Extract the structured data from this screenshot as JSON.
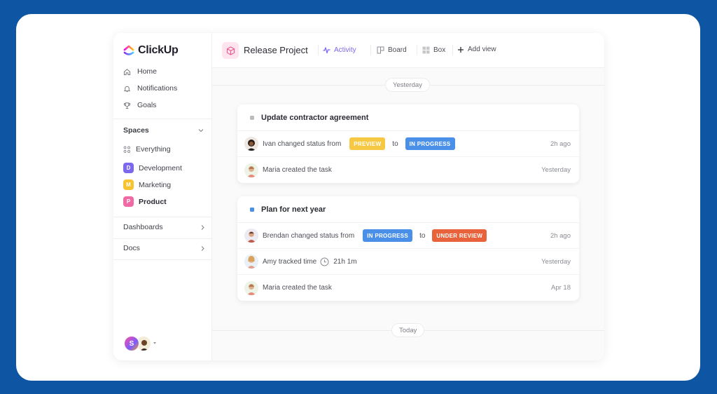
{
  "colors": {
    "background": "#0E55A3",
    "accent": "#7B68EE",
    "preview": "#F7C844",
    "in_progress": "#4A90E8",
    "under_review": "#E8623B"
  },
  "sidebar": {
    "logo_text": "ClickUp",
    "nav": [
      {
        "label": "Home",
        "icon": "home-icon"
      },
      {
        "label": "Notifications",
        "icon": "bell-icon"
      },
      {
        "label": "Goals",
        "icon": "trophy-icon"
      }
    ],
    "spaces_title": "Spaces",
    "everything_label": "Everything",
    "spaces": [
      {
        "letter": "D",
        "label": "Development",
        "color": "#7B68EE"
      },
      {
        "letter": "M",
        "label": "Marketing",
        "color": "#F7C331"
      },
      {
        "letter": "P",
        "label": "Product",
        "color": "#F06AA5"
      }
    ],
    "dashboards_label": "Dashboards",
    "docs_label": "Docs",
    "user_initial": "S"
  },
  "header": {
    "project_title": "Release Project",
    "tabs": [
      {
        "label": "Activity",
        "icon": "activity-icon",
        "active": true
      },
      {
        "label": "Board",
        "icon": "board-icon",
        "active": false
      },
      {
        "label": "Box",
        "icon": "box-grid-icon",
        "active": false
      }
    ],
    "add_view_label": "Add view"
  },
  "feed": {
    "day_labels": [
      "Yesterday",
      "Today"
    ],
    "tasks": [
      {
        "title": "Update contractor agreement",
        "dot_color": "#BDBDBD",
        "activities": [
          {
            "user": "Ivan",
            "text": "Ivan changed status from",
            "from": "PREVIEW",
            "to_word": "to",
            "to": "IN PROGRESS",
            "time": "2h ago"
          },
          {
            "user": "Maria",
            "text": "Maria created the task",
            "time": "Yesterday"
          }
        ]
      },
      {
        "title": "Plan for next year",
        "dot_color": "#4A90E8",
        "activities": [
          {
            "user": "Brendan",
            "text": "Brendan changed status from",
            "from": "IN PROGRESS",
            "to_word": "to",
            "to": "UNDER REVIEW",
            "time": "2h ago"
          },
          {
            "user": "Amy",
            "text": "Amy tracked time",
            "tracked": "21h 1m",
            "time": "Yesterday"
          },
          {
            "user": "Maria",
            "text": "Maria created the task",
            "time": "Apr 18"
          }
        ]
      }
    ]
  }
}
